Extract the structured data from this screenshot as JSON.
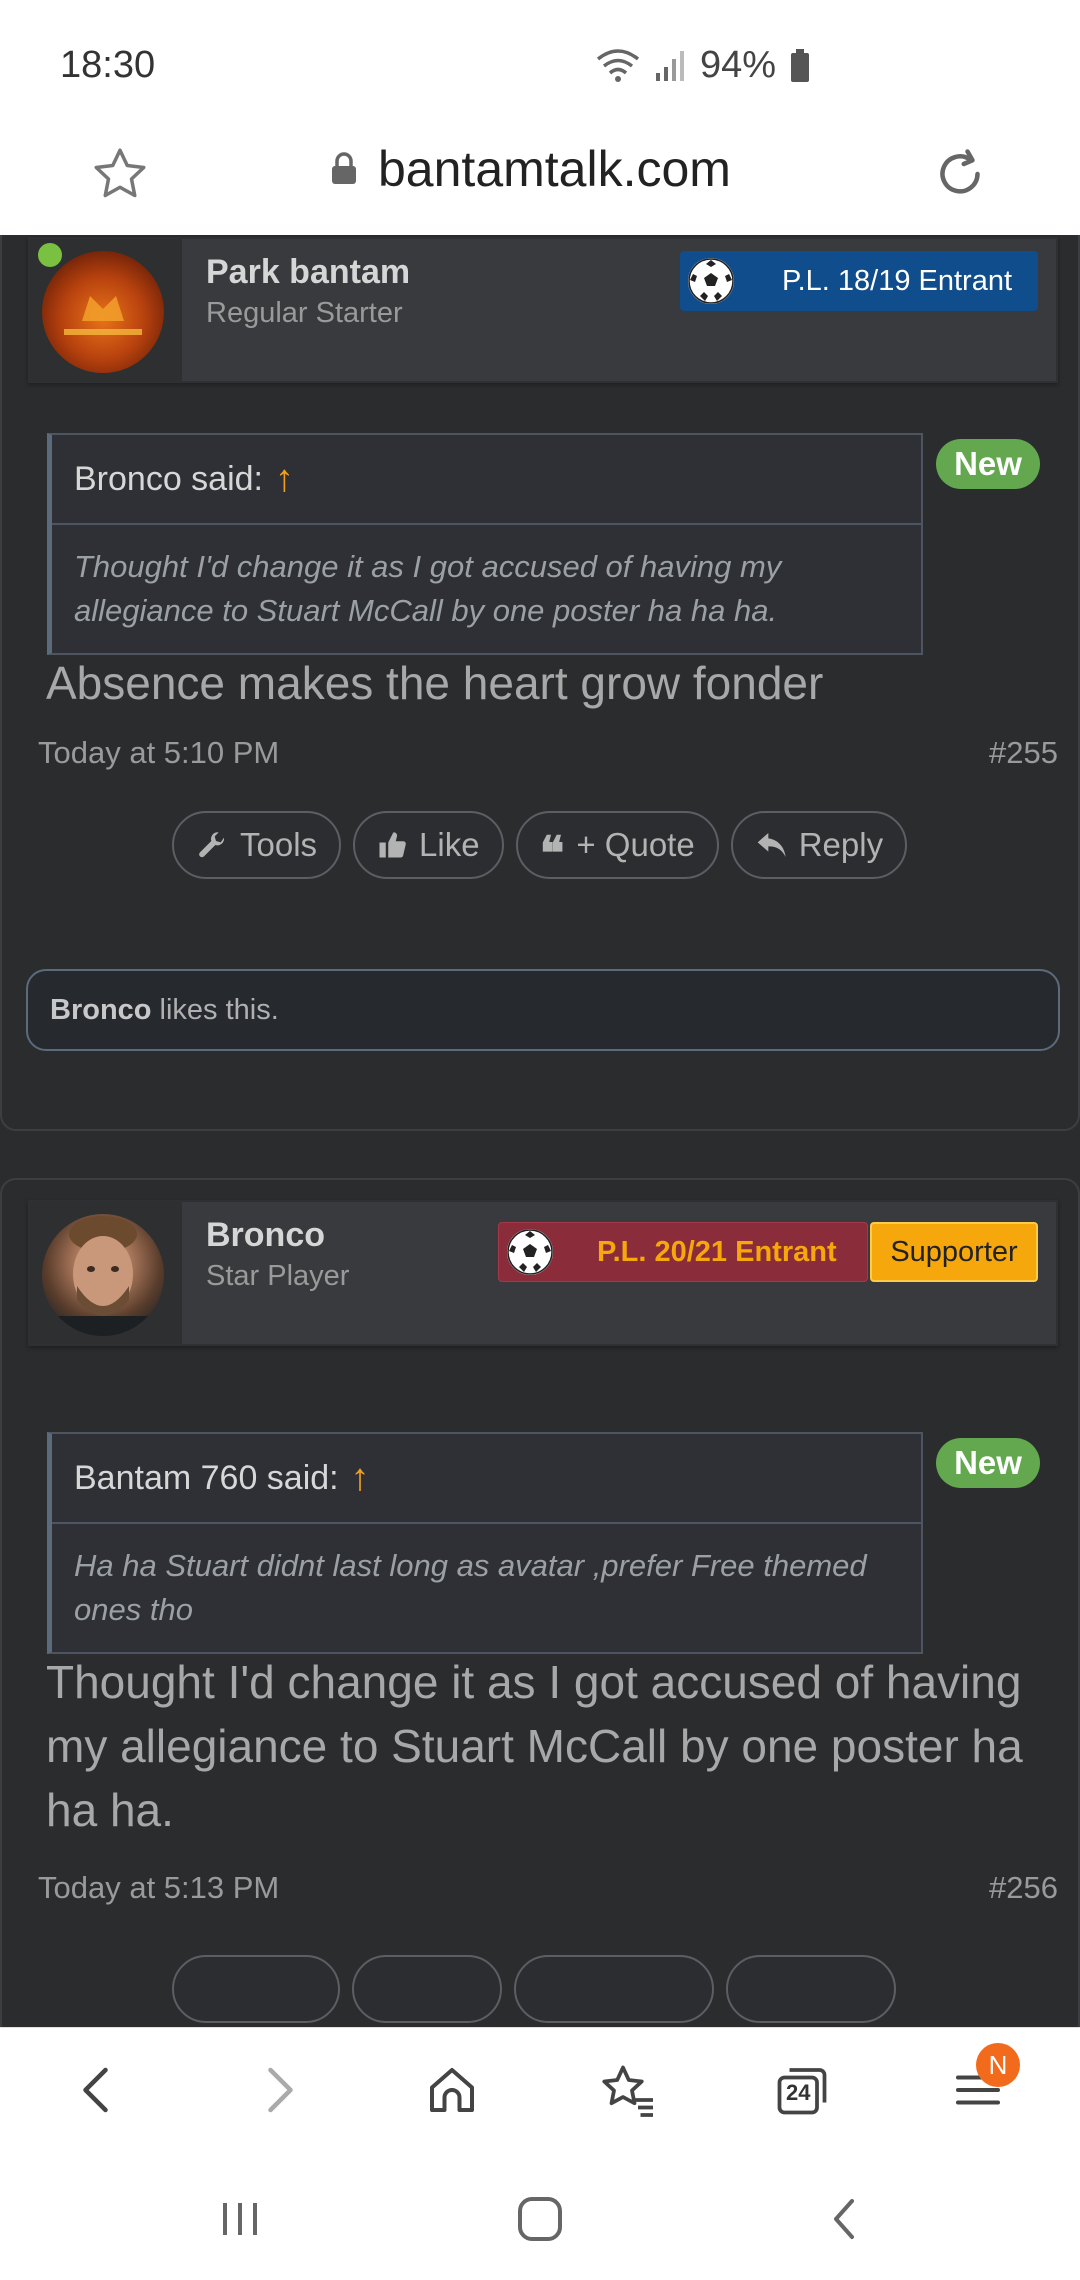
{
  "status": {
    "time": "18:30",
    "battery": "94%"
  },
  "browser": {
    "url": "bantamtalk.com"
  },
  "posts": [
    {
      "user": {
        "name": "Park bantam",
        "title": "Regular Starter",
        "banner": "P.L. 18/19 Entrant"
      },
      "quote": {
        "author": "Bronco said:",
        "text": "Thought I'd change it as I got accused of having my allegiance to Stuart McCall by one poster ha ha ha."
      },
      "badge": "New",
      "message": "Absence makes the heart grow fonder",
      "time": "Today at 5:10 PM",
      "number": "#255",
      "actions": {
        "tools": "Tools",
        "like": "Like",
        "quote": "+ Quote",
        "reply": "Reply"
      },
      "likes": {
        "user": "Bronco",
        "text": "likes this."
      }
    },
    {
      "user": {
        "name": "Bronco",
        "title": "Star Player",
        "banner": "P.L. 20/21 Entrant",
        "banner2": "Supporter"
      },
      "quote": {
        "author": "Bantam 760 said:",
        "text": "Ha ha Stuart didnt last long as avatar ,prefer Free themed ones tho"
      },
      "badge": "New",
      "message": "Thought I'd change it as I got accused of having my allegiance to Stuart McCall by one poster ha ha ha.",
      "time": "Today at 5:13 PM",
      "number": "#256"
    }
  ],
  "toolbar": {
    "tabs_count": "24",
    "notification": "N"
  },
  "colors": {
    "banner_blue": "#0f4d8c",
    "banner_red": "#8b2c3a",
    "supporter": "#f5a70c",
    "accent_orange": "#f0a01e",
    "new_green": "#63a84f"
  }
}
